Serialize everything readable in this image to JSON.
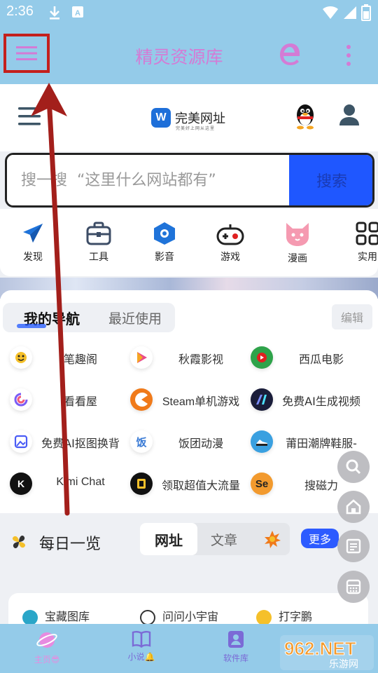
{
  "status_bar": {
    "time": "2:36"
  },
  "app": {
    "title": "精灵资源库"
  },
  "web": {
    "brand": {
      "name": "完美网址",
      "slogan": "完美好上网从这里"
    },
    "search": {
      "placeholder": "搜一搜  “这里什么网站都有”",
      "button": "搜索"
    },
    "categories": [
      {
        "label": "发现",
        "icon": "paper-plane-icon"
      },
      {
        "label": "工具",
        "icon": "toolbox-icon"
      },
      {
        "label": "影音",
        "icon": "play-hexagon-icon"
      },
      {
        "label": "游戏",
        "icon": "gamepad-icon"
      },
      {
        "label": "漫画",
        "icon": "cat-icon"
      },
      {
        "label": "实用",
        "icon": "grid-icon"
      }
    ],
    "nav": {
      "tab_active": "我的导航",
      "tab_inactive": "最近使用",
      "edit": "编辑",
      "sites": [
        {
          "name": "笔趣阁",
          "color": "#f5c02a"
        },
        {
          "name": "秋霞影视",
          "color": "#e94a8b"
        },
        {
          "name": "西瓜电影",
          "color": "#2ea34a"
        },
        {
          "name": "看看屋",
          "color": "#ffffff"
        },
        {
          "name": "Steam单机游戏",
          "color": "#f07a1a"
        },
        {
          "name": "免费AI生成视频",
          "color": "#1a1d3a"
        },
        {
          "name": "免费AI抠图换背",
          "color": "#ffffff"
        },
        {
          "name": "饭团动漫",
          "color": "#ffffff"
        },
        {
          "name": "莆田潮牌鞋服-",
          "color": "#3aa0e0"
        },
        {
          "name": "Kimi Chat",
          "color": "#111111"
        },
        {
          "name": "领取超值大流量",
          "color": "#111111"
        },
        {
          "name": "搜磁力",
          "color": "#f29a2e"
        }
      ]
    },
    "daily": {
      "title": "每日一览",
      "tab_active": "网址",
      "tab_inactive": "文章",
      "more": "更多",
      "entries": [
        "宝藏图库",
        "问问小宇宙",
        "打字鹏"
      ]
    }
  },
  "bottom_nav": [
    {
      "label": "主页😎",
      "icon": "planet-icon"
    },
    {
      "label": "小说🔔",
      "icon": "book-icon"
    },
    {
      "label": "软件库",
      "icon": "badge-icon"
    }
  ],
  "watermark": {
    "top": "962.NET",
    "bottom": "乐游网"
  },
  "colors": {
    "header_bg": "#94cbe9",
    "title_pink": "#d47bd5",
    "accent_blue": "#1f57ff",
    "annotation_red": "#c4201d"
  }
}
